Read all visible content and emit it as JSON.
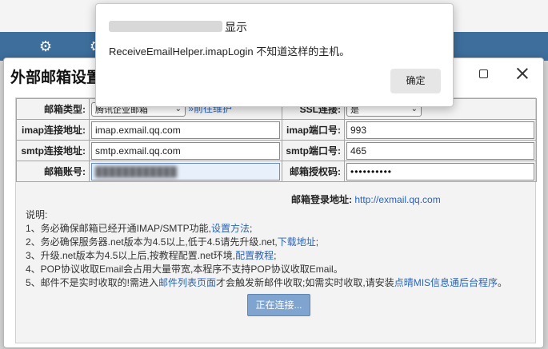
{
  "dialog": {
    "title": "外部邮箱设置"
  },
  "form": {
    "mailbox_type_label": "邮箱类型:",
    "mailbox_type_value": "腾讯企业邮箱",
    "go_maintain_link": "»前往维护",
    "ssl_label": "SSL连接:",
    "ssl_value": "是",
    "imap_addr_label": "imap连接地址:",
    "imap_addr_value": "imap.exmail.qq.com",
    "imap_port_label": "imap端口号:",
    "imap_port_value": "993",
    "smtp_addr_label": "smtp连接地址:",
    "smtp_addr_value": "smtp.exmail.qq.com",
    "smtp_port_label": "smtp端口号:",
    "smtp_port_value": "465",
    "account_label": "邮箱账号:",
    "account_value": "████████████",
    "auth_code_label": "邮箱授权码:",
    "auth_code_value": "••••••••••",
    "login_addr_label": "邮箱登录地址:",
    "login_addr_link": "http://exmail.qq.com"
  },
  "notes": {
    "heading": "说明:",
    "n1_text": "1、务必确保邮箱已经开通IMAP/SMTP功能,",
    "n1_link": "设置方法",
    "n1_end": ";",
    "n2_text": "2、务必确保服务器.net版本为4.5以上,低于4.5请先升级.net,",
    "n2_link": "下载地址",
    "n2_end": ";",
    "n3_text": "3、升级.net版本为4.5以上后,按教程配置.net环境,",
    "n3_link": "配置教程",
    "n3_end": ";",
    "n4_text": "4、POP协议收取Email会占用大量带宽,本程序不支持POP协议收取Email。",
    "n5_text_a": "5、邮件不是实时收取的!需进入",
    "n5_link_a": "邮件列表页面",
    "n5_text_b": "才会触发新邮件收取;如需实时收取,请安装",
    "n5_link_b": "点晴MIS信息通后台程序",
    "n5_end": "。"
  },
  "connect_button": "正在连接...",
  "alert": {
    "title": "显示",
    "message": "ReceiveEmailHelper.imapLogin 不知道这样的主机。",
    "ok_label": "确定"
  },
  "icons": {
    "gear": "gear-icon",
    "maximize": "maximize-icon",
    "close": "close-icon",
    "dropdown": "chevron-down-icon"
  },
  "colors": {
    "app_bar": "#3d6e9c",
    "link": "#2a64b8",
    "connect_button": "#7ea4cf"
  }
}
